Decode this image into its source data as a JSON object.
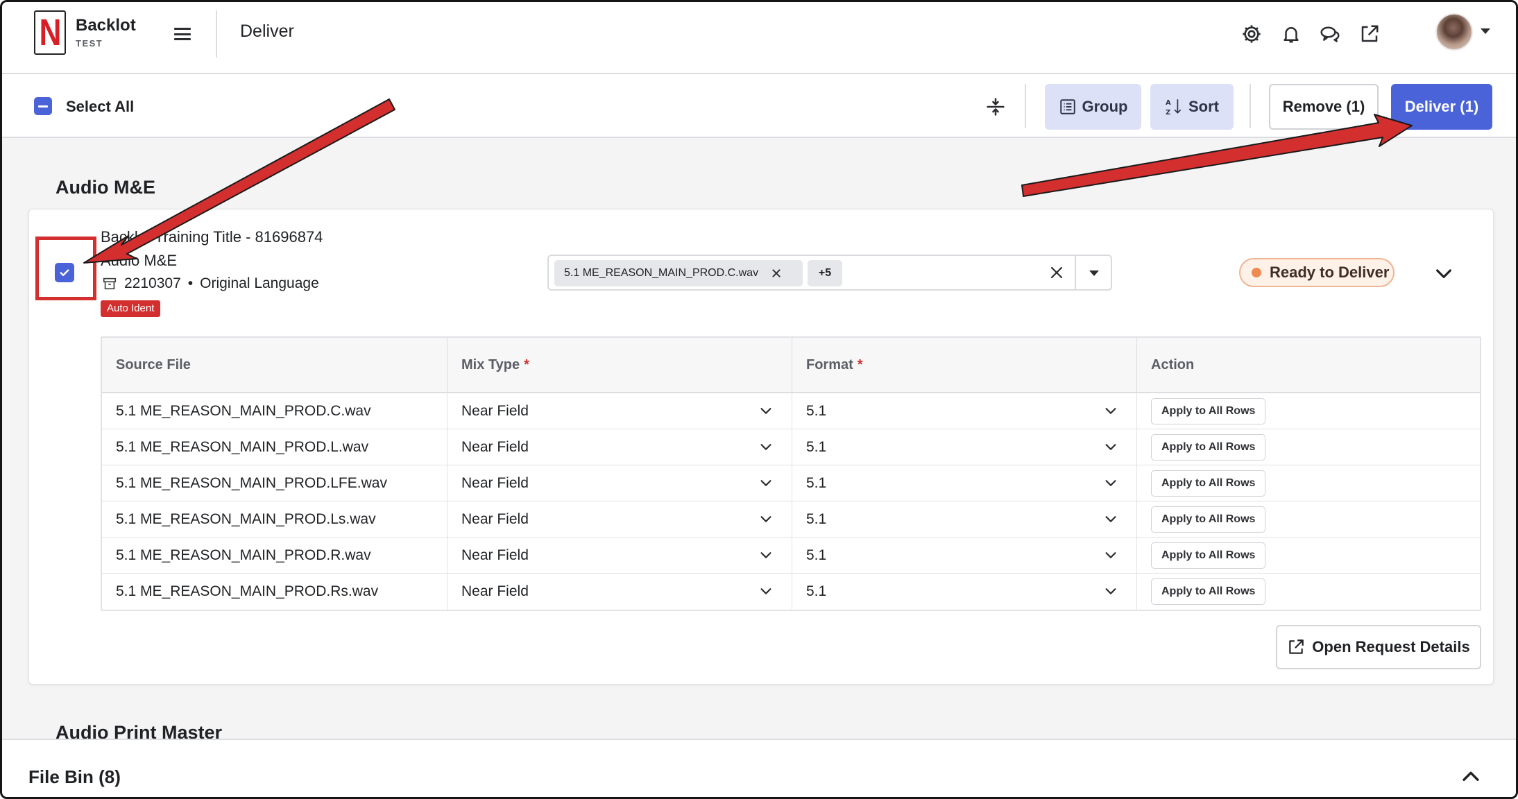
{
  "app": {
    "brand": "Backlot",
    "env": "TEST",
    "page_title": "Deliver"
  },
  "toolbar": {
    "select_all": "Select All",
    "group": "Group",
    "sort": "Sort",
    "remove": "Remove (1)",
    "deliver": "Deliver (1)"
  },
  "section": {
    "title": "Audio M&E"
  },
  "item": {
    "title": "Backlot Training Title - 81696874",
    "subtitle": "Audio M&E",
    "request_id": "2210307",
    "language": "Original Language",
    "badge": "Auto Ident",
    "selected_file": "5.1 ME_REASON_MAIN_PROD.C.wav",
    "more_count": "+5",
    "status": "Ready to Deliver"
  },
  "table": {
    "headers": {
      "source": "Source File",
      "mix": "Mix Type",
      "format": "Format",
      "action": "Action"
    },
    "required_mark": "*",
    "rows": [
      {
        "source": "5.1 ME_REASON_MAIN_PROD.C.wav",
        "mix": "Near Field",
        "format": "5.1",
        "action": "Apply to All Rows"
      },
      {
        "source": "5.1 ME_REASON_MAIN_PROD.L.wav",
        "mix": "Near Field",
        "format": "5.1",
        "action": "Apply to All Rows"
      },
      {
        "source": "5.1 ME_REASON_MAIN_PROD.LFE.wav",
        "mix": "Near Field",
        "format": "5.1",
        "action": "Apply to All Rows"
      },
      {
        "source": "5.1 ME_REASON_MAIN_PROD.Ls.wav",
        "mix": "Near Field",
        "format": "5.1",
        "action": "Apply to All Rows"
      },
      {
        "source": "5.1 ME_REASON_MAIN_PROD.R.wav",
        "mix": "Near Field",
        "format": "5.1",
        "action": "Apply to All Rows"
      },
      {
        "source": "5.1 ME_REASON_MAIN_PROD.Rs.wav",
        "mix": "Near Field",
        "format": "5.1",
        "action": "Apply to All Rows"
      }
    ]
  },
  "open_details": "Open Request Details",
  "next_section": {
    "title": "Audio Print Master"
  },
  "file_bin": {
    "title": "File Bin (8)"
  },
  "icons": [
    "settings-icon",
    "bell-icon",
    "chat-icon",
    "external-link-icon",
    "avatar"
  ],
  "colors": {
    "primary": "#4a63d9",
    "annotation": "#d32f2f",
    "status": "#ef8a52",
    "brand": "#d81f26"
  }
}
